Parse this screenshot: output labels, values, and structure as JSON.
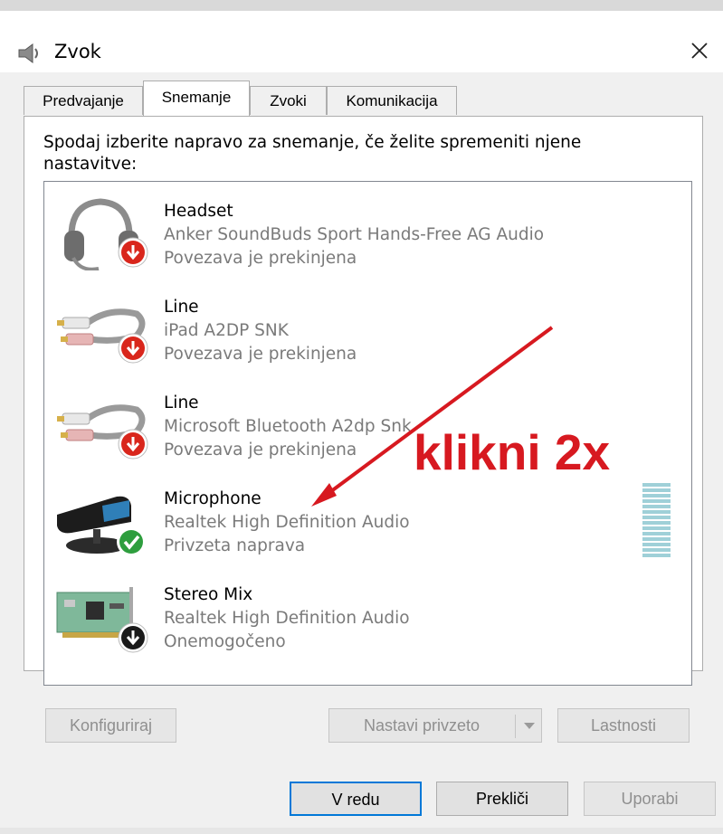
{
  "window": {
    "title": "Zvok",
    "close_icon": "close-icon"
  },
  "tabs": [
    {
      "label": "Predvajanje",
      "active": false
    },
    {
      "label": "Snemanje",
      "active": true
    },
    {
      "label": "Zvoki",
      "active": false
    },
    {
      "label": "Komunikacija",
      "active": false
    }
  ],
  "instruction": "Spodaj izberite napravo za snemanje, če želite spremeniti njene nastavitve:",
  "devices": [
    {
      "name": "Headset",
      "description": "Anker SoundBuds Sport Hands-Free AG Audio",
      "status": "Povezava je prekinjena",
      "icon": "headset-icon",
      "badge": "disconnected-badge-icon"
    },
    {
      "name": "Line",
      "description": "iPad A2DP SNK",
      "status": "Povezava je prekinjena",
      "icon": "line-in-cable-icon",
      "badge": "disconnected-badge-icon"
    },
    {
      "name": "Line",
      "description": "Microsoft Bluetooth A2dp Snk",
      "status": "Povezava je prekinjena",
      "icon": "line-in-cable-icon",
      "badge": "disconnected-badge-icon"
    },
    {
      "name": "Microphone",
      "description": "Realtek High Definition Audio",
      "status": "Privzeta naprava",
      "icon": "microphone-icon",
      "badge": "default-device-check-icon"
    },
    {
      "name": "Stereo Mix",
      "description": "Realtek High Definition Audio",
      "status": "Onemogočeno",
      "icon": "sound-card-icon",
      "badge": "disabled-badge-icon"
    }
  ],
  "annotation": {
    "text": "klikni 2x",
    "color": "#d71920"
  },
  "buttons": {
    "configure": "Konfiguriraj",
    "set_default": "Nastavi privzeto",
    "properties": "Lastnosti",
    "ok": "V redu",
    "cancel": "Prekliči",
    "apply": "Uporabi"
  },
  "colors": {
    "accent": "#0078d7",
    "disconnected_badge": "#d9261c",
    "default_badge": "#2e9e3e",
    "level_meter": "#9fd0d8"
  }
}
